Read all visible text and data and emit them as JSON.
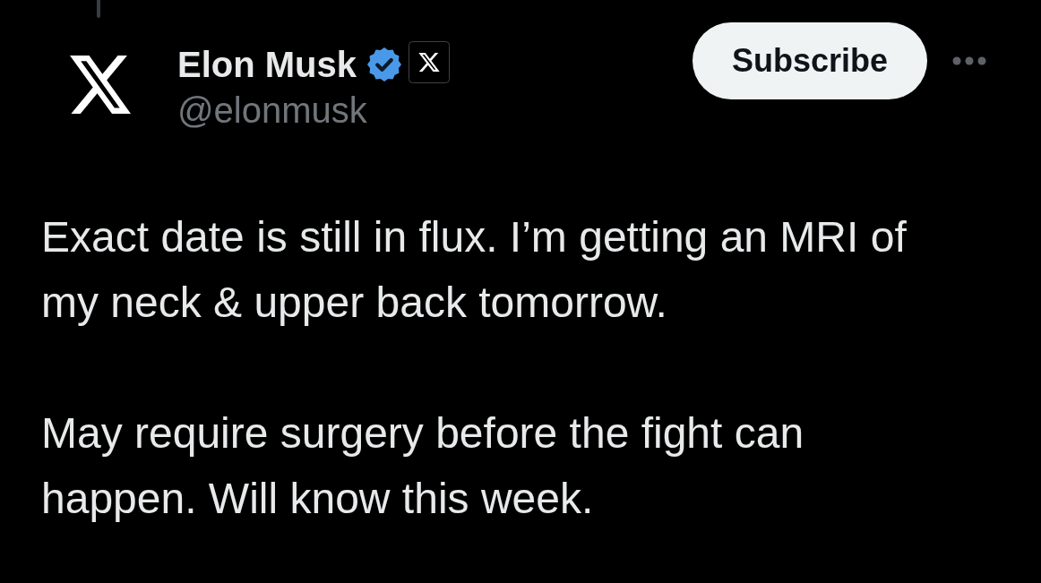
{
  "post": {
    "author": {
      "name": "Elon Musk",
      "handle": "@elonmusk",
      "verified": true,
      "affiliate_badge": true
    },
    "subscribe_button": "Subscribe",
    "paragraphs": [
      "Exact date is still in flux. I’m getting an MRI of my neck & upper back tomorrow.",
      "May require surgery before the fight can happen. Will know this week."
    ]
  }
}
